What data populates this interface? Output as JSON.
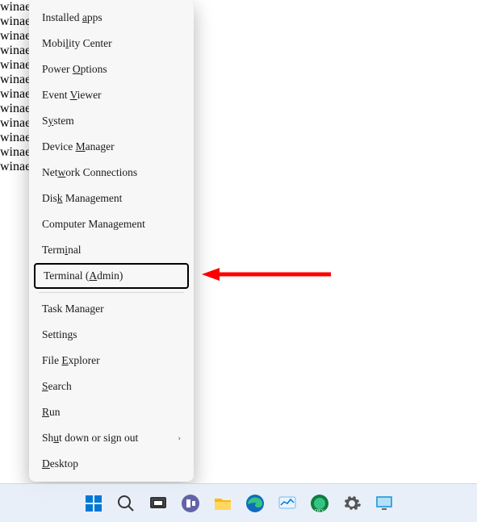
{
  "watermarks": [
    "winaero.com",
    "winaero.com",
    "winaero.com",
    "winaero.com",
    "winaero.com",
    "winaero.com",
    "winaero.com",
    "winaero.com",
    "winaero.com"
  ],
  "menu": {
    "items": [
      {
        "label": "Installed apps",
        "mnemonic_index": 10
      },
      {
        "label": "Mobility Center",
        "mnemonic_index": 4
      },
      {
        "label": "Power Options",
        "mnemonic_index": 6
      },
      {
        "label": "Event Viewer",
        "mnemonic_index": 6
      },
      {
        "label": "System",
        "mnemonic_index": 1
      },
      {
        "label": "Device Manager",
        "mnemonic_index": 7
      },
      {
        "label": "Network Connections",
        "mnemonic_index": 3
      },
      {
        "label": "Disk Management",
        "mnemonic_index": 3
      },
      {
        "label": "Computer Management",
        "mnemonic_index": null
      },
      {
        "label": "Terminal",
        "mnemonic_index": 4
      },
      {
        "label": "Terminal (Admin)",
        "mnemonic_index": 10,
        "highlighted": true
      }
    ],
    "items2": [
      {
        "label": "Task Manager",
        "mnemonic_index": null
      },
      {
        "label": "Settings",
        "mnemonic_index": 6
      },
      {
        "label": "File Explorer",
        "mnemonic_index": 5
      },
      {
        "label": "Search",
        "mnemonic_index": 0
      },
      {
        "label": "Run",
        "mnemonic_index": 0
      },
      {
        "label": "Shut down or sign out",
        "mnemonic_index": 2,
        "submenu": true
      },
      {
        "label": "Desktop",
        "mnemonic_index": 0
      }
    ]
  },
  "taskbar": {
    "icons": [
      "start",
      "search",
      "task-view",
      "chat",
      "file-explorer",
      "edge",
      "widget-monitor",
      "edge-dev",
      "settings",
      "screen-tool"
    ]
  },
  "annotation": {
    "arrow_direction": "left",
    "arrow_color": "#ff0000"
  }
}
